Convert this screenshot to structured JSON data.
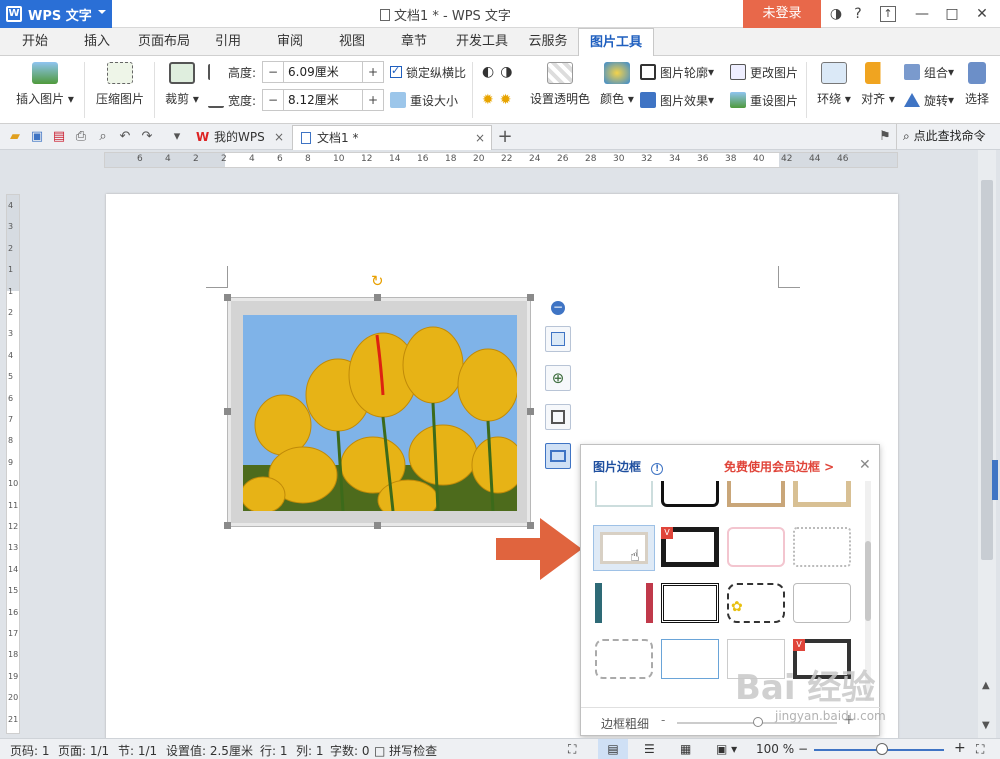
{
  "titlebar": {
    "app_label": "WPS 文字",
    "doc_title": "文档1 * - WPS 文字",
    "login_label": "未登录",
    "help_label": "?"
  },
  "menu": {
    "items": [
      "开始",
      "插入",
      "页面布局",
      "引用",
      "审阅",
      "视图",
      "章节",
      "开发工具",
      "云服务",
      "图片工具"
    ],
    "active": "图片工具"
  },
  "ribbon": {
    "insert_picture": "插入图片",
    "compress_picture": "压缩图片",
    "crop": "裁剪",
    "height_label": "高度:",
    "height_value": "6.09厘米",
    "width_label": "宽度:",
    "width_value": "8.12厘米",
    "lock_ratio": "锁定纵横比",
    "reset_size": "重设大小",
    "set_transparent": "设置透明色",
    "color": "颜色",
    "picture_outline": "图片轮廓",
    "picture_effect": "图片效果",
    "change_picture": "更改图片",
    "reset_picture": "重设图片",
    "wrap": "环绕",
    "align": "对齐",
    "group": "组合",
    "rotate": "旋转",
    "select": "选择"
  },
  "tabs": {
    "my_wps": "我的WPS",
    "doc1": "文档1 *",
    "search_label": "点此查找命令"
  },
  "ruler": {
    "h_ticks": [
      "6",
      "4",
      "2",
      "2",
      "4",
      "6",
      "8",
      "10",
      "12",
      "14",
      "16",
      "18",
      "20",
      "22",
      "24",
      "26",
      "28",
      "30",
      "32",
      "34",
      "36",
      "38",
      "40",
      "42",
      "44",
      "46"
    ],
    "v_ticks": [
      "4",
      "3",
      "2",
      "1",
      "1",
      "2",
      "3",
      "4",
      "5",
      "6",
      "7",
      "8",
      "9",
      "10",
      "11",
      "12",
      "13",
      "14",
      "15",
      "16",
      "17",
      "18",
      "19",
      "20",
      "21"
    ]
  },
  "border_panel": {
    "title": "图片边框",
    "vip_link": "免费使用会员边框 >",
    "thickness_label": "边框粗细",
    "minus": "-",
    "plus": "+"
  },
  "statusbar": {
    "page_num": "页码: 1",
    "pages": "页面: 1/1",
    "section": "节: 1/1",
    "setting": "设置值: 2.5厘米",
    "line": "行: 1",
    "column": "列: 1",
    "words": "字数: 0",
    "spell_check": "拼写检查",
    "zoom": "100 %"
  },
  "watermark": {
    "text": "Bai 经验",
    "url": "jingyan.baidu.com"
  },
  "colors": {
    "accent": "#2a6fd6",
    "login": "#e8684a",
    "arrow": "#e0643e",
    "vip": "#e0453a"
  }
}
